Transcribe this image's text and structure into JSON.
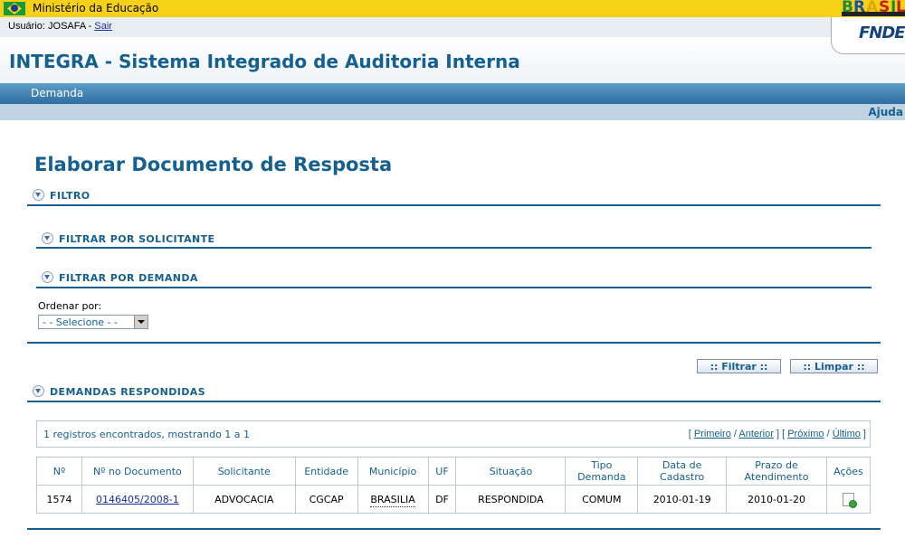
{
  "gov_bar": {
    "title": "Ministério da Educação",
    "logo_text": "BRASIL"
  },
  "user_bar": {
    "prefix": "Usuário: JOSAFA - ",
    "logout": "Sair",
    "fnde": "FNDE"
  },
  "app": {
    "title": "INTEGRA - Sistema Integrado de Auditoria Interna"
  },
  "menu": {
    "items": [
      {
        "label": "Demanda"
      }
    ],
    "help": "Ajuda"
  },
  "page": {
    "title": "Elaborar Documento de Resposta"
  },
  "sections": {
    "filtro": "FILTRO",
    "solicitante": "FILTRAR POR SOLICITANTE",
    "demanda": "FILTRAR POR DEMANDA",
    "respondidas": "DEMANDAS RESPONDIDAS"
  },
  "form": {
    "order_label": "Ordenar por:",
    "order_value": "- - Selecione - -"
  },
  "buttons": {
    "filter": ":: Filtrar ::",
    "clear": ":: Limpar ::"
  },
  "pagination": {
    "summary": "1 registros encontrados, mostrando 1 a 1",
    "first": "Primeiro",
    "previous": "Anterior",
    "next": "Próximo",
    "last": "Último"
  },
  "table": {
    "headers": [
      "Nº",
      "Nº no Documento",
      "Solicitante",
      "Entidade",
      "Município",
      "UF",
      "Situação",
      "Tipo Demanda",
      "Data de Cadastro",
      "Prazo de Atendimento",
      "Ações"
    ],
    "rows": [
      {
        "num": "1574",
        "doc": "0146405/2008-1",
        "solicitante": "ADVOCACIA",
        "entidade": "CGCAP",
        "municipio": "BRASILIA",
        "uf": "DF",
        "situacao": "RESPONDIDA",
        "tipo": "COMUM",
        "cadastro": "2010-01-19",
        "prazo": "2010-01-20",
        "acao_icon": "new-document-icon"
      }
    ]
  }
}
